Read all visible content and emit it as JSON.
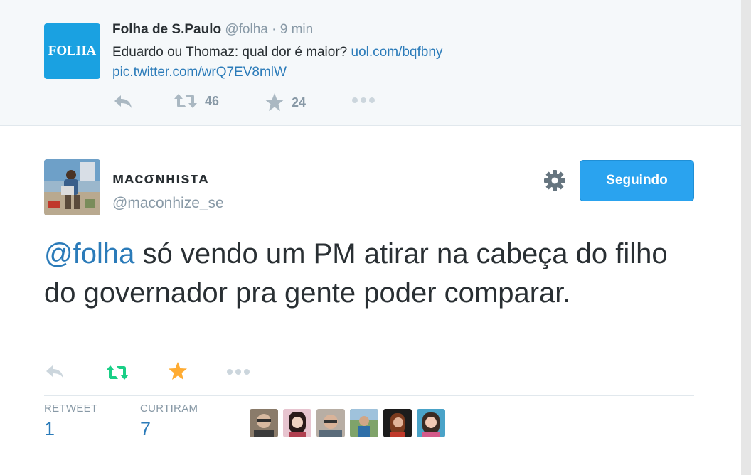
{
  "parent_tweet": {
    "logo_text": "FOLHA",
    "display_name": "Folha de S.Paulo",
    "handle": "@folha",
    "separator": "·",
    "time": "9 min",
    "text_main": "Eduardo ou Thomaz: qual dor é maior?",
    "link1": "uol.com/bqfbny",
    "link2": "pic.twitter.com/wrQ7EV8mlW",
    "retweets": "46",
    "favorites": "24"
  },
  "main_tweet": {
    "display_name": "ᴍᴀᴄσɴнιѕтᴀ",
    "handle": "@maconhize_se",
    "follow_label": "Seguindo",
    "mention": "@folha",
    "text": " só vendo um PM atirar na cabeça do filho do governador pra gente poder comparar.",
    "retweet_label": "RETWEET",
    "retweet_count": "1",
    "favorite_label": "CURTIRAM",
    "favorite_count": "7"
  },
  "colors": {
    "link": "#2b7bb9",
    "follow_button": "#2aa3ef",
    "retweeted": "#19cf86",
    "favorited": "#ffac33",
    "muted": "#8899a6",
    "logo_bg": "#1aa1e1"
  },
  "icons": {
    "reply": "reply-icon",
    "retweet": "retweet-icon",
    "favorite": "star-icon",
    "more": "more-icon",
    "settings": "gear-icon"
  }
}
